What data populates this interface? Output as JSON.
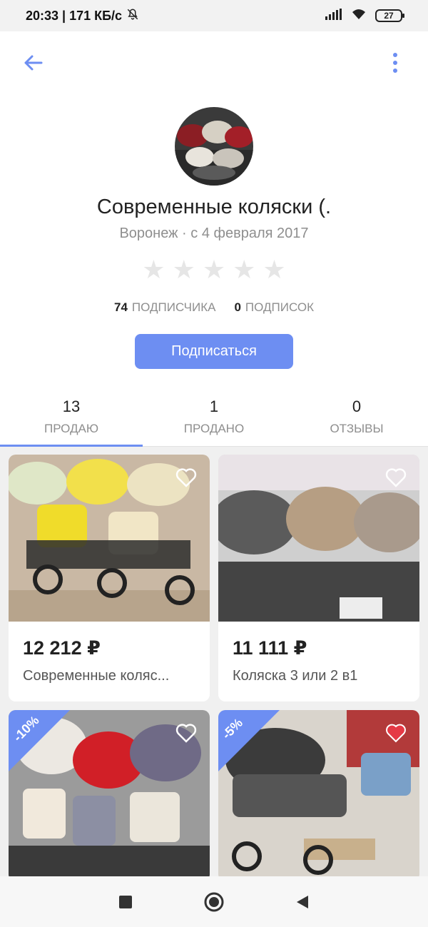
{
  "status_bar": {
    "time_speed": "20:33 | 171 КБ/с",
    "battery": "27"
  },
  "app_bar": {
    "back_icon": "arrow-left-icon",
    "menu_icon": "more-vertical-icon"
  },
  "profile": {
    "title": "Современные коляски (.",
    "subtitle": "Воронеж · с 4 февраля 2017",
    "rating_stars": 5,
    "subscribers_count": "74",
    "subscribers_label": "ПОДПИСЧИКА",
    "subscriptions_count": "0",
    "subscriptions_label": "ПОДПИСОК",
    "subscribe_button": "Подписаться"
  },
  "tabs": [
    {
      "count": "13",
      "label": "ПРОДАЮ",
      "active": true
    },
    {
      "count": "1",
      "label": "ПРОДАНО",
      "active": false
    },
    {
      "count": "0",
      "label": "ОТЗЫВЫ",
      "active": false
    }
  ],
  "listings": [
    {
      "price": "12 212 ₽",
      "title": "Современные коляс...",
      "favorite": false,
      "discount": ""
    },
    {
      "price": "11 111 ₽",
      "title": "Коляска 3 или 2 в1",
      "favorite": false,
      "discount": ""
    },
    {
      "price": "",
      "title": "",
      "favorite": false,
      "discount": "-10%"
    },
    {
      "price": "",
      "title": "",
      "favorite": true,
      "discount": "-5%"
    }
  ],
  "colors": {
    "accent": "#6d8ef2",
    "favorite_red": "#e53945",
    "text_secondary": "#8e8e8e"
  }
}
